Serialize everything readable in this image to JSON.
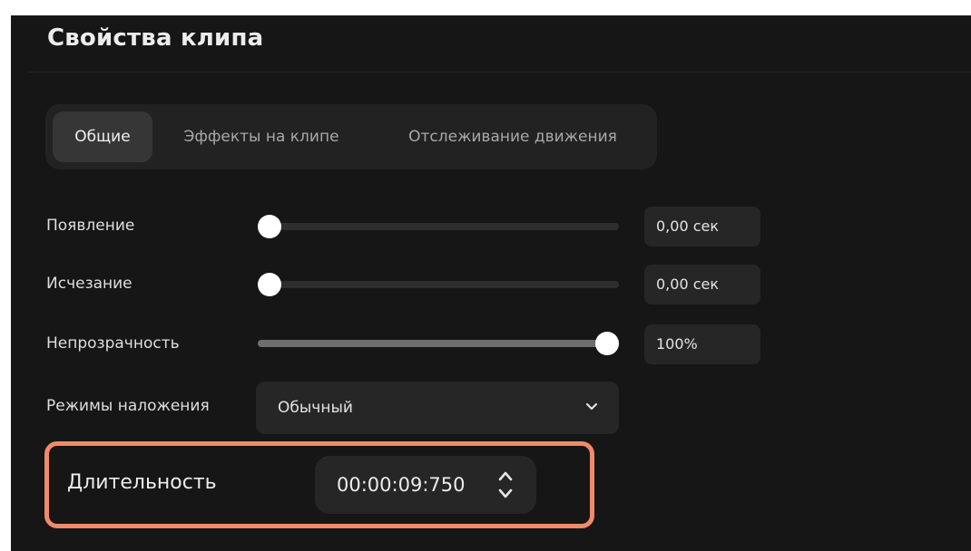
{
  "panel": {
    "title": "Свойства клипа"
  },
  "tabs": [
    {
      "label": "Общие",
      "active": true
    },
    {
      "label": "Эффекты на клипе",
      "active": false
    },
    {
      "label": "Отслеживание движения",
      "active": false
    }
  ],
  "fade_in": {
    "label": "Появление",
    "value_text": "0,00 сек",
    "level_percent": 0
  },
  "fade_out": {
    "label": "Исчезание",
    "value_text": "0,00 сек",
    "level_percent": 0
  },
  "opacity": {
    "label": "Непрозрачность",
    "value_text": "100%",
    "level_percent": 100
  },
  "blend_mode": {
    "label": "Режимы наложения",
    "selected": "Обычный",
    "icon": "chevron-down-icon"
  },
  "duration": {
    "label": "Длительность",
    "value": "00:00:09:750",
    "icon": "stepper-up-down-icon"
  },
  "colors": {
    "panel_bg": "#161616",
    "control_bg": "#262626",
    "highlight": "#f08a6a",
    "slider_thumb": "#ffffff"
  }
}
